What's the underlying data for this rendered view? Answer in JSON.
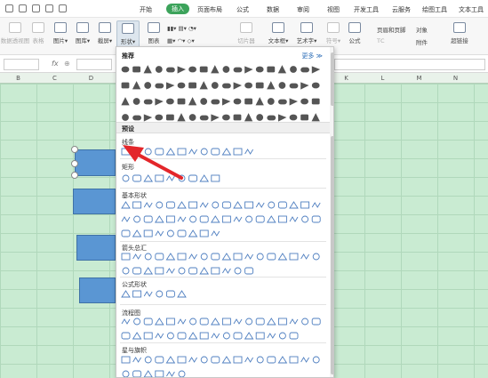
{
  "menu": {
    "tabs": [
      "开始",
      "插入",
      "页面布局",
      "公式",
      "数据",
      "审阅",
      "视图",
      "开发工具",
      "云服务",
      "绘图工具",
      "文本工具"
    ],
    "active_tab": "插入"
  },
  "ribbon": {
    "buttons": [
      "数据透视图",
      "表格",
      "图片",
      "图库",
      "截屏",
      "形状",
      "图表",
      "切片器",
      "文本框",
      "艺术字",
      "符号",
      "公式",
      "超链接"
    ],
    "page_header_footer": "页眉和页脚",
    "object": "对象",
    "attachment": "附件",
    "tc": "ТС"
  },
  "formula_bar": {
    "fx": "fx"
  },
  "columns": [
    "B",
    "C",
    "D",
    "E",
    "F",
    "G",
    "H",
    "I",
    "J",
    "K",
    "L",
    "M",
    "N"
  ],
  "shape_panel": {
    "recent_label": "推荐",
    "more_label": "更多",
    "presets_label": "预设",
    "sections": [
      "线条",
      "矩形",
      "基本形状",
      "箭头总汇",
      "公式形状",
      "流程图",
      "星与旗帜"
    ]
  },
  "colors": {
    "active_tab": "#3ca35b",
    "grid": "#c9ebd2",
    "shape_fill": "#5a96d3",
    "arrow": "#e3262a",
    "link": "#2f6fb8"
  }
}
